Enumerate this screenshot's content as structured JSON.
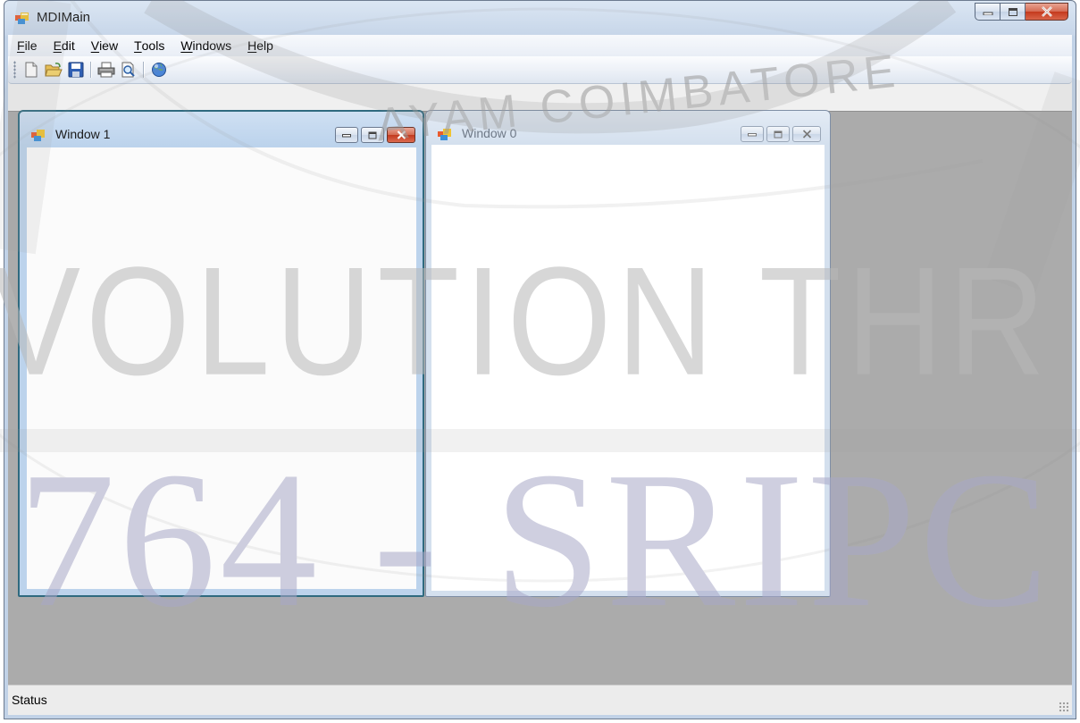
{
  "main_window": {
    "title": "MDIMain"
  },
  "menu": {
    "items": [
      {
        "mnemonic": "F",
        "rest": "ile"
      },
      {
        "mnemonic": "E",
        "rest": "dit"
      },
      {
        "mnemonic": "V",
        "rest": "iew"
      },
      {
        "mnemonic": "T",
        "rest": "ools"
      },
      {
        "mnemonic": "W",
        "rest": "indows"
      },
      {
        "mnemonic": "H",
        "rest": "elp"
      }
    ]
  },
  "toolbar": {
    "buttons": [
      "new-file-icon",
      "open-folder-icon",
      "save-icon",
      "print-icon",
      "print-preview-icon",
      "help-globe-icon"
    ]
  },
  "children": [
    {
      "title": "Window 1",
      "active": true
    },
    {
      "title": "Window 0",
      "active": false
    }
  ],
  "status_bar": {
    "text": "Status"
  },
  "watermark": {
    "line1": "VOLUTION THR  UGH TECHNOLO",
    "line2": "764 - SRIPC",
    "arc": "AYAM COIMBATORE"
  },
  "colors": {
    "mdi_background": "#ababab",
    "active_close": "#c4391d",
    "title_bar": "#c7d6e9"
  }
}
